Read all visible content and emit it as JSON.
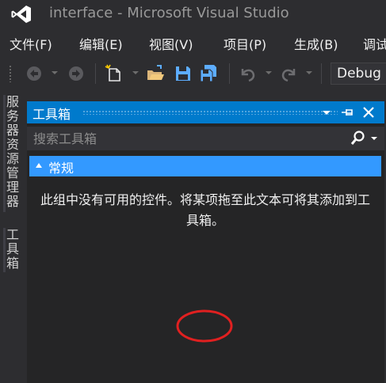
{
  "window": {
    "title": "interface - Microsoft Visual Studio"
  },
  "menu": {
    "items": [
      "文件(F)",
      "编辑(E)",
      "视图(V)",
      "项目(P)",
      "生成(B)",
      "调试"
    ]
  },
  "toolbar": {
    "configuration": "Debug",
    "icons": [
      "back-icon",
      "forward-icon",
      "new-project-icon",
      "open-file-icon",
      "save-icon",
      "save-all-icon",
      "undo-icon",
      "redo-icon"
    ]
  },
  "side_tabs": {
    "server_explorer": "服务器资源管理器",
    "toolbox": "工具箱"
  },
  "toolbox": {
    "title": "工具箱",
    "search_placeholder": "搜索工具箱",
    "group_label": "常规",
    "empty_message": "此组中没有可用的控件。将某项拖至此文本可将其添加到工具箱。"
  },
  "colors": {
    "background": "#2d2d30",
    "panel": "#252526",
    "accent_header": "#007acc",
    "group_header": "#3399ff",
    "text": "#f1f1f1",
    "annotation": "#e02020"
  }
}
